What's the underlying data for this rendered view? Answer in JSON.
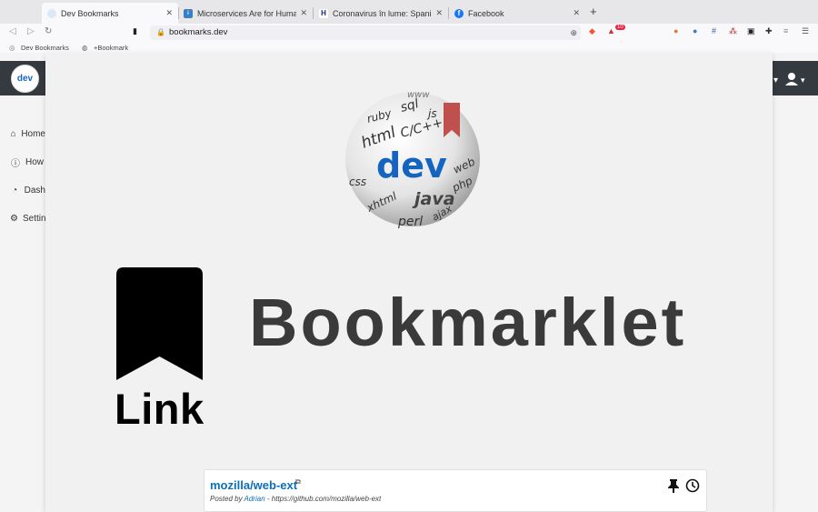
{
  "browser": {
    "tabs": [
      {
        "label": "Dev Bookmarks",
        "favicon": "dev-globe-icon",
        "active": true
      },
      {
        "label": "Microservices Are for Humans, N",
        "favicon": "info-icon",
        "active": false
      },
      {
        "label": "Coronavirus în lume: Spania și F",
        "favicon": "h-icon",
        "active": false
      },
      {
        "label": "Facebook",
        "favicon": "facebook-icon",
        "active": false
      }
    ],
    "url": "bookmarks.dev",
    "shields_count": "10",
    "bookmarks_bar": {
      "item1": "Dev Bookmarks",
      "item2": "+Bookmark"
    }
  },
  "site": {
    "logo_text": "dev",
    "sidebar": [
      {
        "label": "Home",
        "icon": "home-icon"
      },
      {
        "label": "How",
        "icon": "info-icon"
      },
      {
        "label": "Dash",
        "icon": "dashboard-icon"
      },
      {
        "label": "Settings",
        "icon": "gear-icon"
      }
    ]
  },
  "splash": {
    "globe_words": [
      "www",
      "sql",
      "js",
      "ruby",
      "html",
      "C/C++",
      "dev",
      "web",
      "php",
      "css",
      "java",
      "xhtml",
      "ajax",
      "perl",
      "htm"
    ],
    "bookmark_label": "Link",
    "headline": "Bookmarklet"
  },
  "card": {
    "title": "mozilla/web-ext",
    "posted_by_label": "Posted by",
    "author": "Adrian",
    "url_text": " - https://github.com/mozilla/web-ext"
  },
  "colors": {
    "accent_link": "#0b6fb8",
    "navbar": "#343a40",
    "globe_dev": "#1565c0",
    "globe_ribbon": "#c0504d"
  }
}
